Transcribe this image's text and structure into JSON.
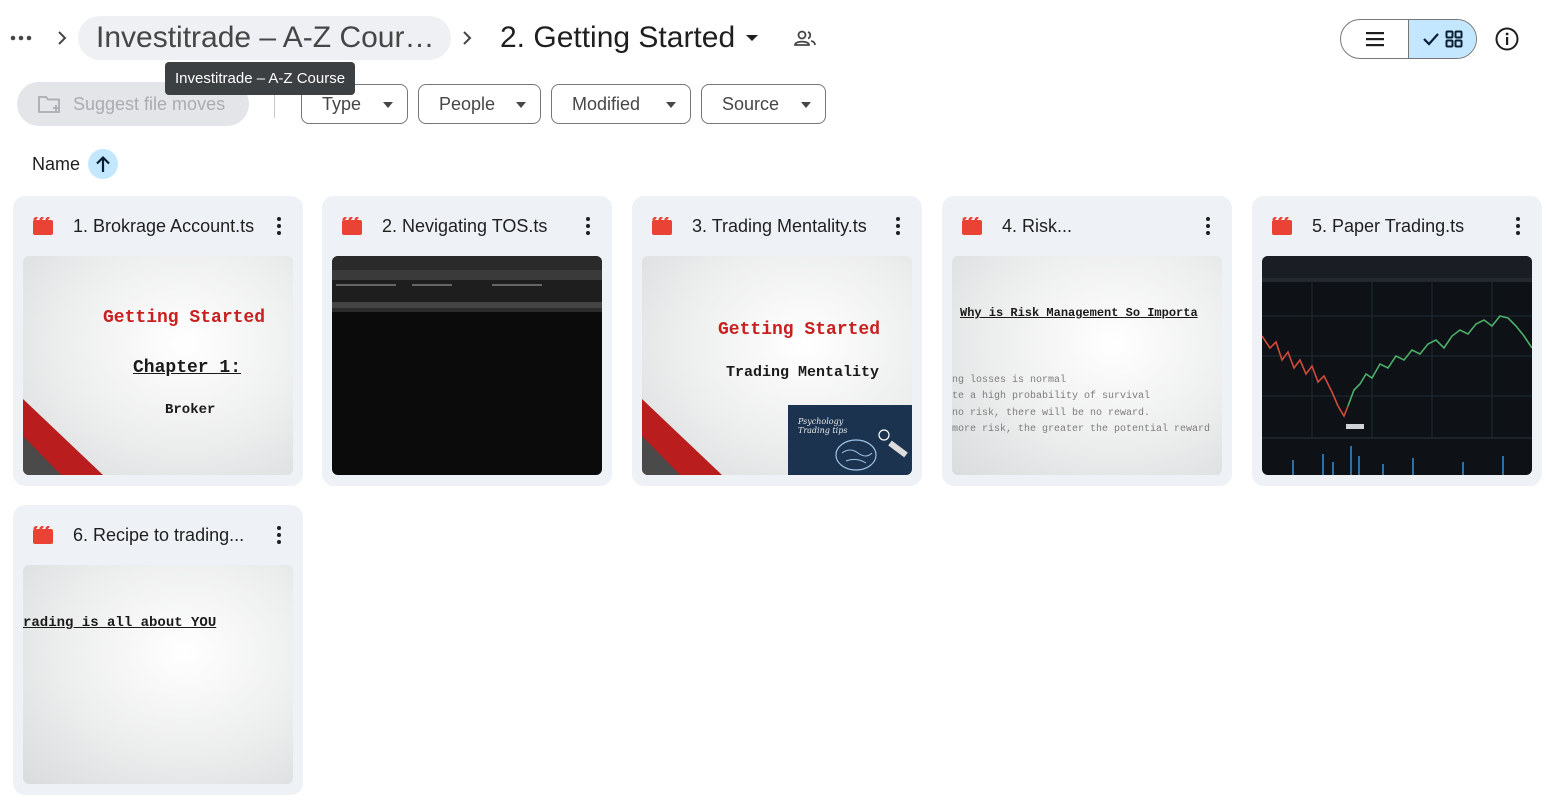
{
  "breadcrumb": {
    "parent_label": "Investitrade – A-Z Cour…",
    "current_label": "2. Getting Started",
    "tooltip": "Investitrade – A-Z Course"
  },
  "icons": {
    "more": "more-horizontal-icon",
    "chevron": "chevron-right-icon",
    "caret": "caret-down-icon",
    "shared": "people-icon",
    "list_view": "list-icon",
    "grid_view": "grid-icon",
    "info": "info-icon",
    "video_file": "video-file-icon",
    "kebab": "more-vertical-icon"
  },
  "toolbar": {
    "suggest_label": "Suggest file moves",
    "filters": [
      "Type",
      "People",
      "Modified",
      "Source"
    ]
  },
  "sort": {
    "label": "Name",
    "direction": "ascending"
  },
  "colors": {
    "accent_light": "#c2e7ff",
    "video_icon_red": "#ea4335",
    "card_bg": "#eef1f6",
    "tooltip_bg": "#3c4043"
  },
  "files": [
    {
      "name": "1. Brokrage Account.ts",
      "thumb_lines": [
        "Getting Started",
        "Chapter 1:",
        "Broker"
      ]
    },
    {
      "name": "2. Nevigating TOS.ts",
      "thumb_lines": []
    },
    {
      "name": "3. Trading Mentality.ts",
      "thumb_lines": [
        "Getting Started",
        "Trading Mentality",
        "Psychology",
        "Trading tips"
      ]
    },
    {
      "name": "4. Risk...",
      "thumb_lines": [
        "Why is Risk Management So Importa",
        "ng losses is normal",
        "te a high probability of survival",
        "no risk, there will be no reward.",
        "more risk, the greater the potential reward"
      ]
    },
    {
      "name": "5. Paper Trading.ts",
      "thumb_lines": []
    },
    {
      "name": "6. Recipe to trading...",
      "thumb_lines": [
        "rading is all about YOU"
      ]
    }
  ]
}
